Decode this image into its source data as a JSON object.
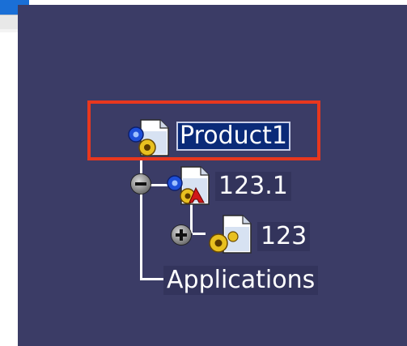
{
  "tree": {
    "root": {
      "label": "Product1",
      "icon": "product-icon",
      "selected": true
    },
    "children": [
      {
        "label": "123.1",
        "icon": "part-instance-icon",
        "toggle": "collapse",
        "children": [
          {
            "label": "123",
            "icon": "part-icon",
            "toggle": "expand"
          }
        ]
      },
      {
        "label": "Applications",
        "icon": ""
      }
    ]
  },
  "colors": {
    "viewport_background": "#3b3c66",
    "selection_box": "#e8371e",
    "selected_label_background": "#0a2a78"
  }
}
